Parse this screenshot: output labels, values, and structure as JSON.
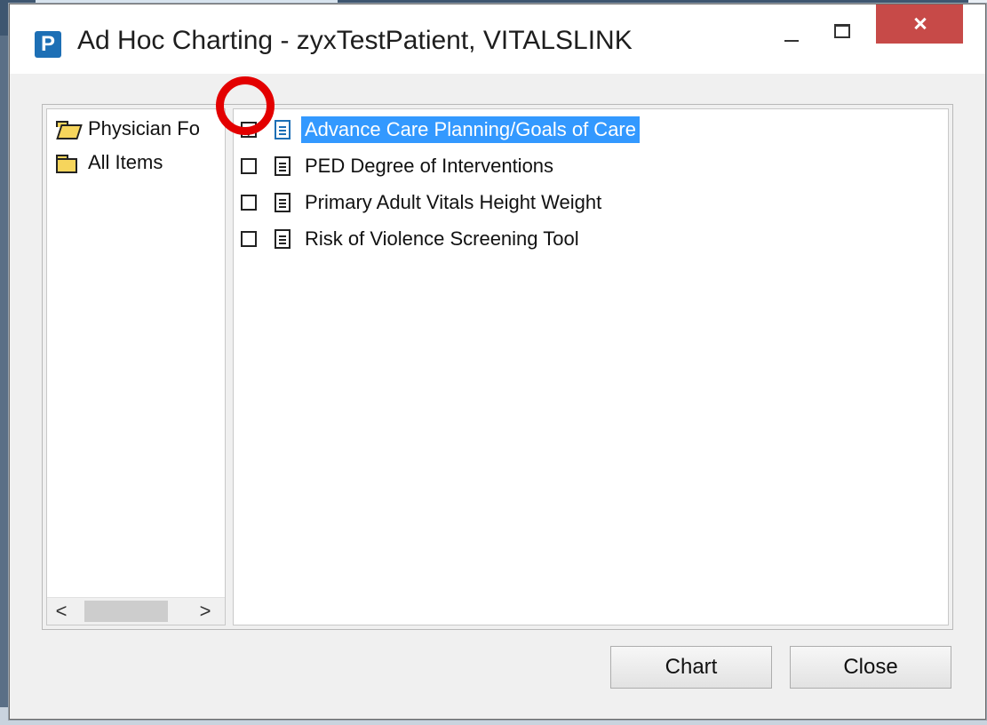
{
  "window": {
    "title": "Ad Hoc Charting - zyxTestPatient, VITALSLINK",
    "app_icon_letter": "P"
  },
  "tree": {
    "items": [
      {
        "label": "Physician Fo",
        "icon": "folder-open-icon"
      },
      {
        "label": "All Items",
        "icon": "folder-icon"
      }
    ],
    "scroll_left": "<",
    "scroll_right": ">"
  },
  "list": {
    "items": [
      {
        "label": "Advance Care Planning/Goals of Care",
        "checked": true,
        "selected": true
      },
      {
        "label": "PED Degree of Interventions",
        "checked": false,
        "selected": false
      },
      {
        "label": "Primary Adult Vitals Height Weight",
        "checked": false,
        "selected": false
      },
      {
        "label": "Risk of Violence Screening Tool",
        "checked": false,
        "selected": false
      }
    ]
  },
  "buttons": {
    "chart": "Chart",
    "close": "Close"
  },
  "colors": {
    "selection": "#3399ff",
    "close_button": "#c74a48",
    "annotation": "#e30000"
  }
}
